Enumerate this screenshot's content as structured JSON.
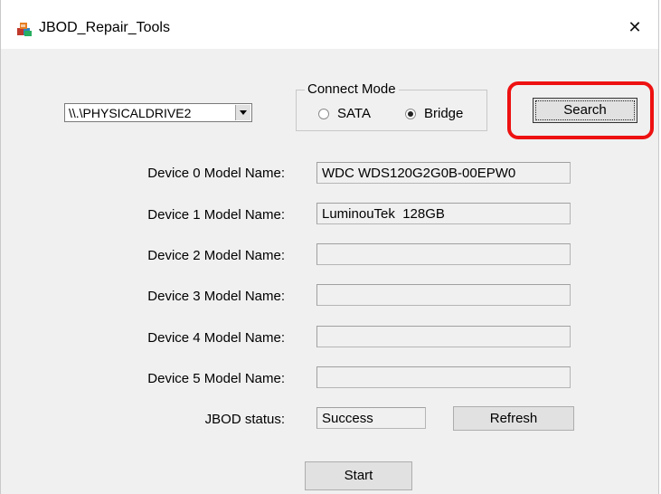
{
  "window": {
    "title": "JBOD_Repair_Tools",
    "close_glyph": "✕"
  },
  "drive": {
    "selected": "\\\\.\\PHYSICALDRIVE2"
  },
  "connect_mode": {
    "legend": "Connect Mode",
    "options": [
      {
        "label": "SATA",
        "checked": false
      },
      {
        "label": "Bridge",
        "checked": true
      }
    ]
  },
  "buttons": {
    "search": "Search",
    "refresh": "Refresh",
    "start": "Start"
  },
  "devices": [
    {
      "label": "Device 0 Model Name:",
      "value": "WDC WDS120G2G0B-00EPW0"
    },
    {
      "label": "Device 1 Model Name:",
      "value": "LuminouTek  128GB"
    },
    {
      "label": "Device 2 Model Name:",
      "value": ""
    },
    {
      "label": "Device 3 Model Name:",
      "value": ""
    },
    {
      "label": "Device 4 Model Name:",
      "value": ""
    },
    {
      "label": "Device 5 Model Name:",
      "value": ""
    }
  ],
  "status": {
    "label": "JBOD status:",
    "value": "Success"
  },
  "colors": {
    "highlight": "#ee1111",
    "dialog_bg": "#f0f0f0"
  }
}
